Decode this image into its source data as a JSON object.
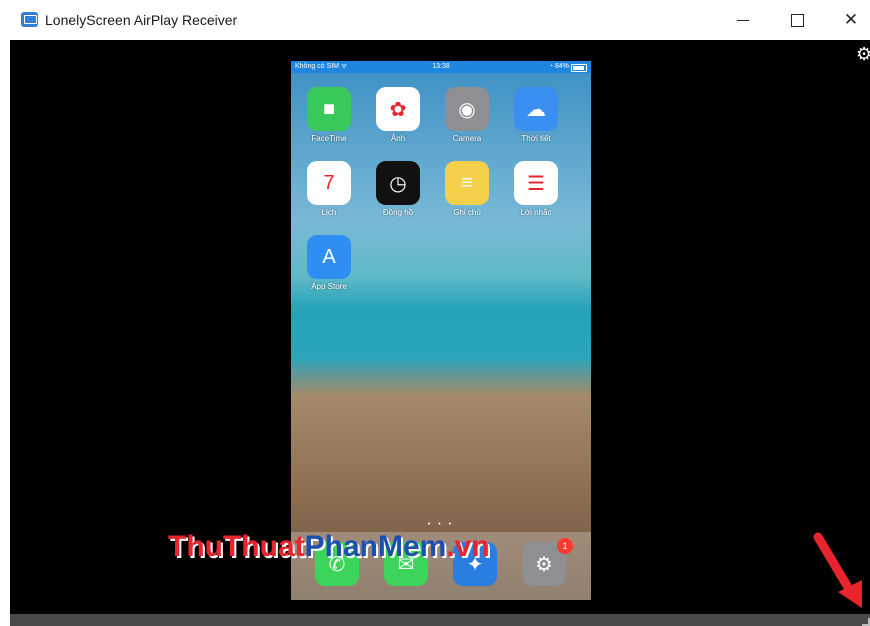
{
  "window": {
    "title": "LonelyScreen AirPlay Receiver",
    "controls": {
      "minimize": "—",
      "maximize": "☐",
      "close": "✕"
    }
  },
  "settings_icon": "⚙",
  "phone": {
    "status": {
      "carrier": "Không có SIM ᯤ",
      "time": "13:38",
      "battery": "◔ 84%"
    },
    "apps": [
      {
        "label": "FaceTime",
        "glyph": "■",
        "color": "#38c95a"
      },
      {
        "label": "Ảnh",
        "glyph": "✿",
        "color": "#ffffff"
      },
      {
        "label": "Camera",
        "glyph": "◉",
        "color": "#8e8e93"
      },
      {
        "label": "Thời tiết",
        "glyph": "☁",
        "color": "#3a8ff0"
      },
      {
        "label": "Lịch",
        "glyph": "7",
        "color": "#ffffff"
      },
      {
        "label": "Đồng hồ",
        "glyph": "◷",
        "color": "#111111"
      },
      {
        "label": "Ghi chú",
        "glyph": "≡",
        "color": "#f5d04a"
      },
      {
        "label": "Lời nhắc",
        "glyph": "☰",
        "color": "#ffffff"
      },
      {
        "label": "App Store",
        "glyph": "A",
        "color": "#2f8ef1"
      }
    ],
    "page_dots": "• • •",
    "dock": [
      {
        "name": "phone",
        "glyph": "✆",
        "color": "#3dd45c"
      },
      {
        "name": "messages",
        "glyph": "✉",
        "color": "#3dd45c"
      },
      {
        "name": "safari",
        "glyph": "✦",
        "color": "#2a7de1"
      },
      {
        "name": "settings",
        "glyph": "⚙",
        "color": "#8e8e93"
      }
    ],
    "settings_badge": "1"
  },
  "watermark": {
    "part1": "ThuThuat",
    "part2": "PhanMem",
    "part3": ".vn"
  },
  "colors": {
    "accent": "#2f7ed8",
    "watermark_red": "#e8242f",
    "watermark_blue": "#1f4fae",
    "arrow": "#e8242f"
  }
}
